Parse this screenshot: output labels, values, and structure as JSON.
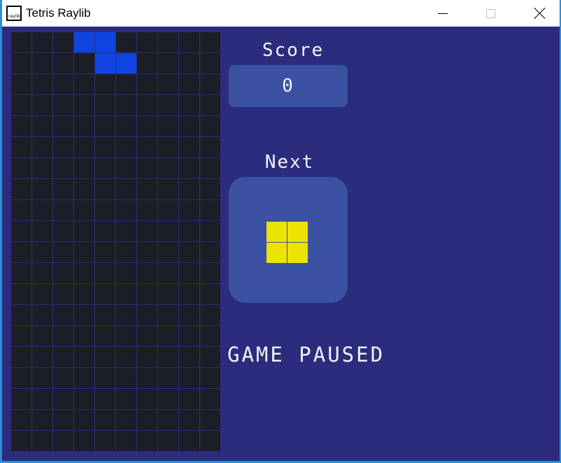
{
  "window": {
    "title": "Tetris Raylib",
    "icon_text": "raylib",
    "icon": "raylib-logo-icon",
    "controls": [
      "minimize-icon",
      "maximize-icon",
      "close-icon"
    ]
  },
  "board": {
    "rows": 20,
    "cols": 10,
    "cell_color": "#1c1e27",
    "grid_line_color": "#2c2c7f",
    "active_piece": {
      "type": "Z",
      "color": "#0f44e0",
      "cells": [
        [
          0,
          3
        ],
        [
          0,
          4
        ],
        [
          1,
          4
        ],
        [
          1,
          5
        ]
      ]
    }
  },
  "score": {
    "label": "Score",
    "value": "0"
  },
  "next": {
    "label": "Next",
    "piece": "O",
    "color": "#ede300",
    "cells": [
      [
        0,
        0
      ],
      [
        0,
        1
      ],
      [
        1,
        0
      ],
      [
        1,
        1
      ]
    ]
  },
  "status": {
    "text": "GAME PAUSED"
  },
  "colors": {
    "background": "#2c2c7f",
    "panel": "#3a52a1",
    "text": "#f2f2f2"
  }
}
